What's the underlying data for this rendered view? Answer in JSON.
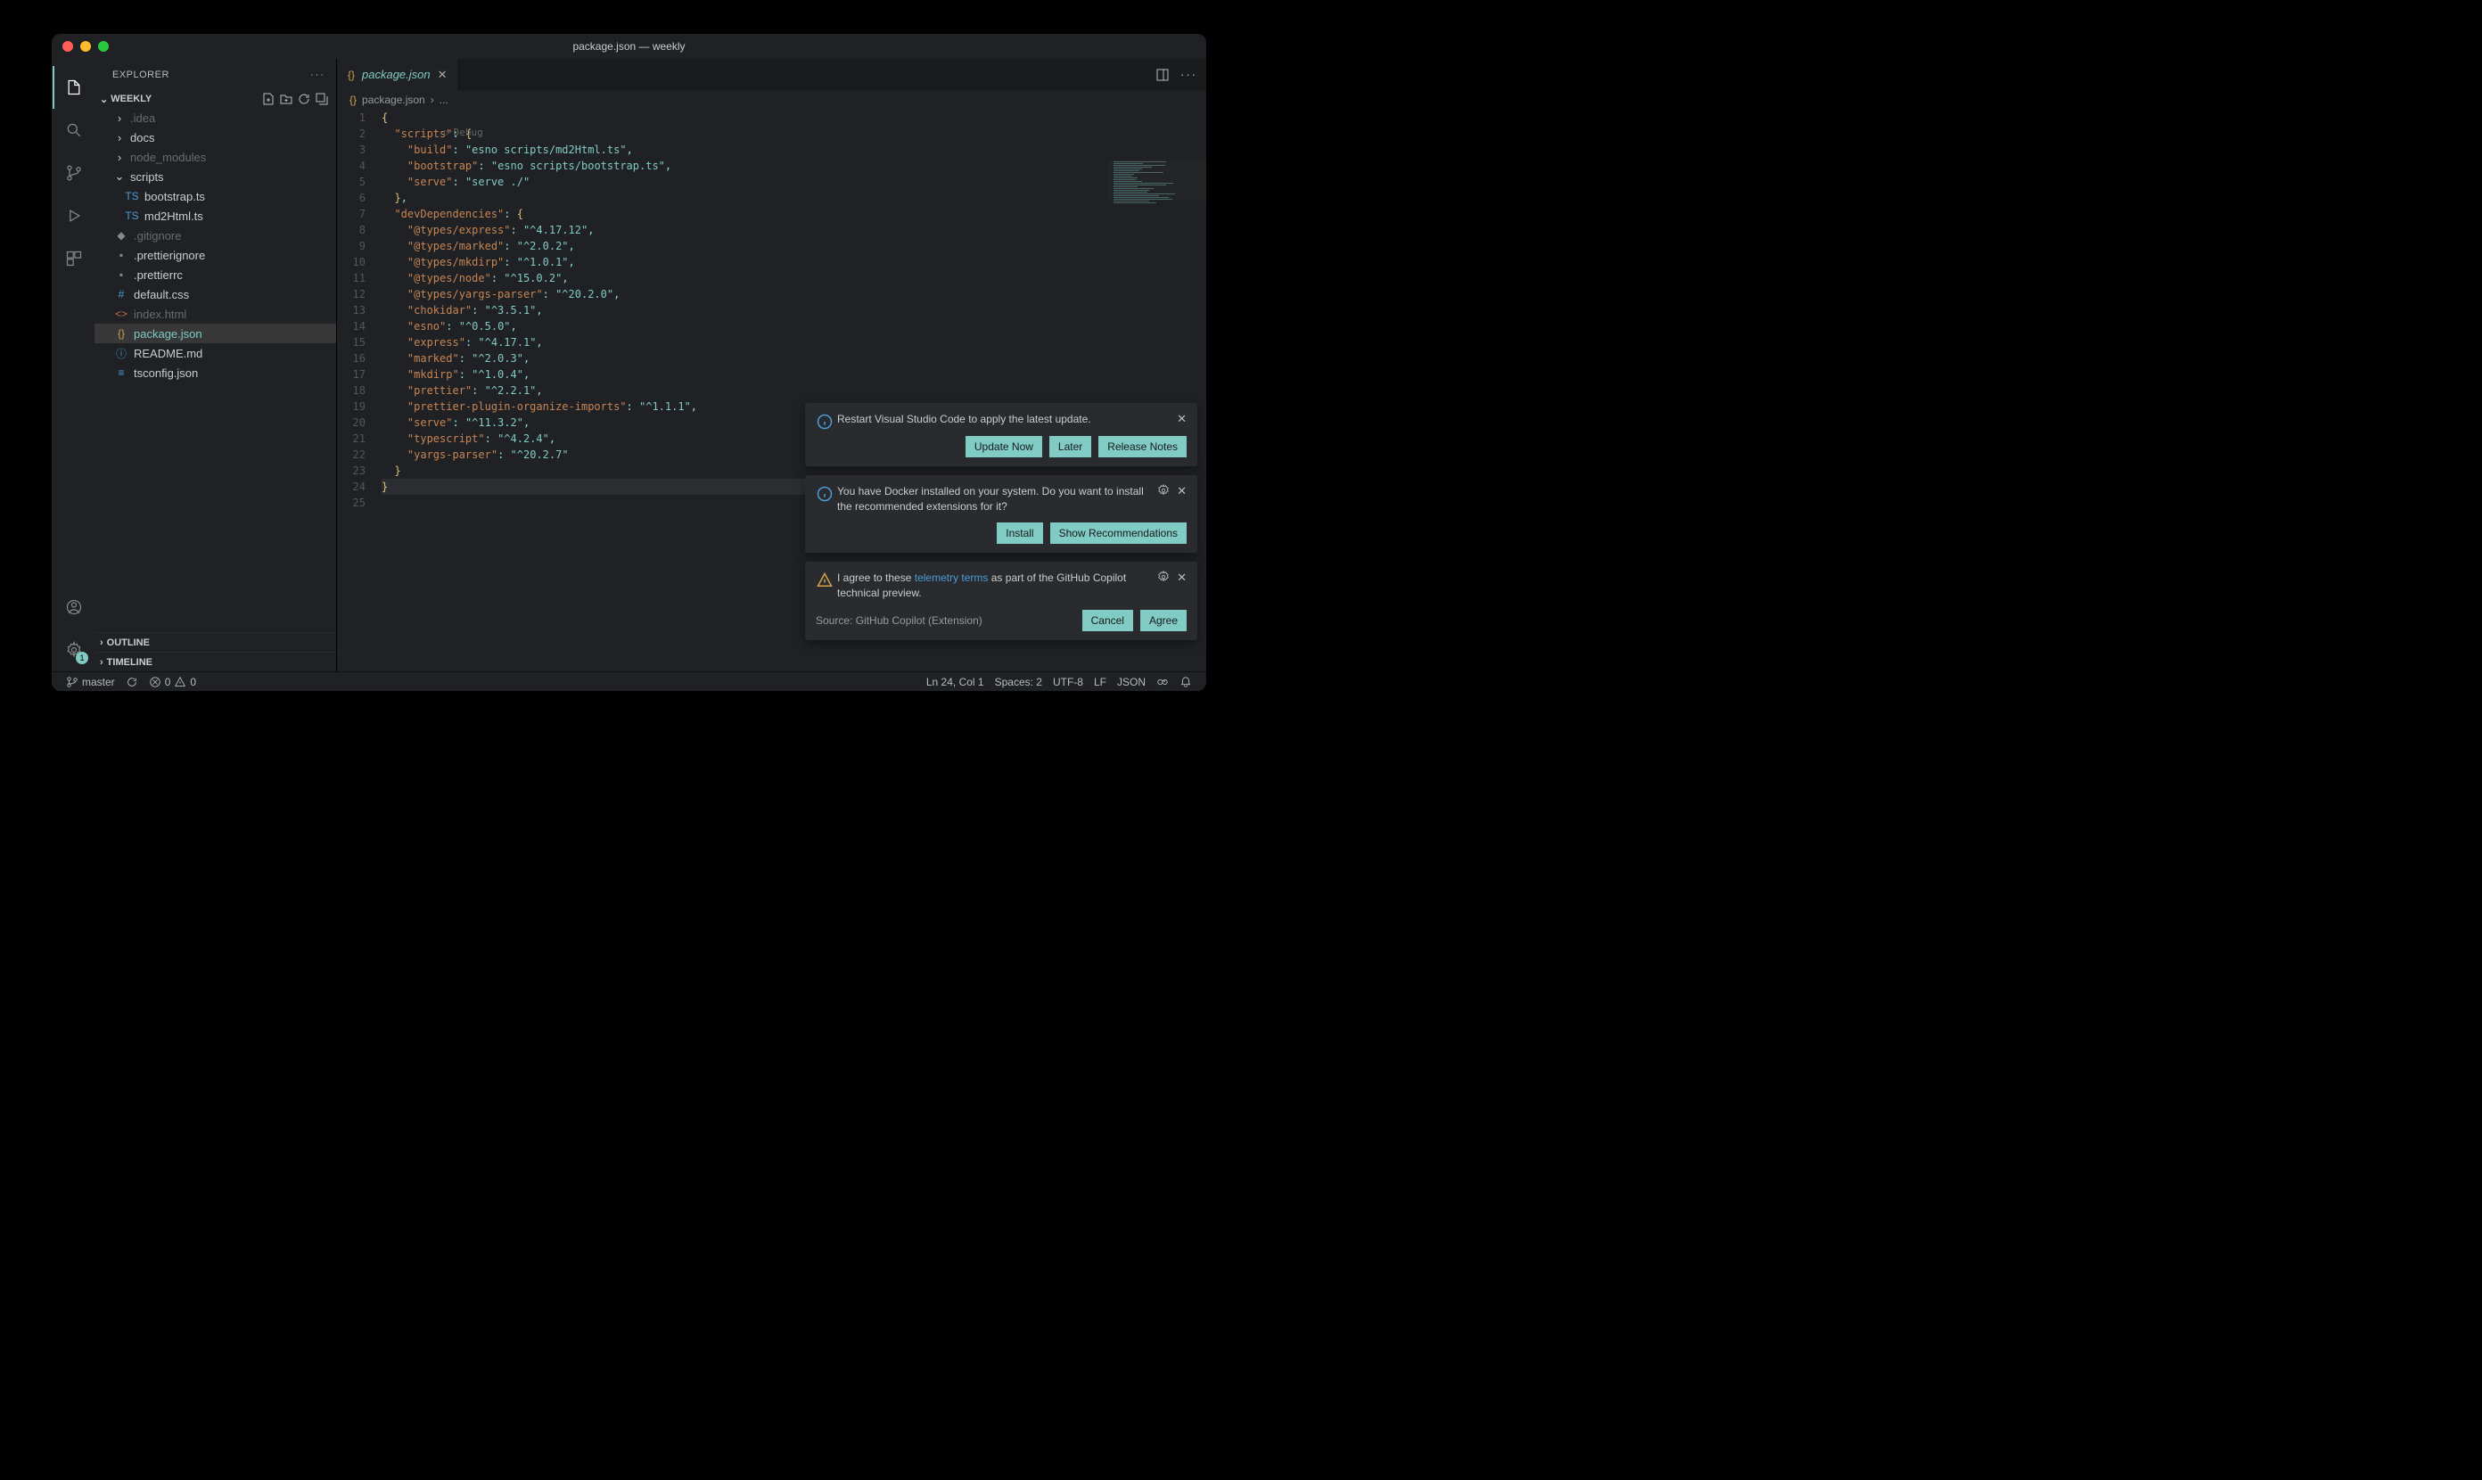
{
  "titlebar": {
    "title": "package.json — weekly"
  },
  "activitybar": {
    "settings_badge": "1"
  },
  "sidebar": {
    "header": "EXPLORER",
    "project": "WEEKLY",
    "tree": [
      {
        "name": ".idea",
        "type": "folder",
        "dim": true,
        "depth": 1
      },
      {
        "name": "docs",
        "type": "folder",
        "dim": false,
        "depth": 1
      },
      {
        "name": "node_modules",
        "type": "folder",
        "dim": true,
        "depth": 1
      },
      {
        "name": "scripts",
        "type": "folder",
        "dim": false,
        "depth": 1,
        "expanded": true
      },
      {
        "name": "bootstrap.ts",
        "type": "file",
        "icon": "TS",
        "iconColor": "#4a9dd8",
        "depth": 2
      },
      {
        "name": "md2Html.ts",
        "type": "file",
        "icon": "TS",
        "iconColor": "#4a9dd8",
        "depth": 2
      },
      {
        "name": ".gitignore",
        "type": "file",
        "icon": "◆",
        "iconColor": "#888",
        "dim": true,
        "depth": 1
      },
      {
        "name": ".prettierignore",
        "type": "file",
        "icon": "▪",
        "iconColor": "#888",
        "depth": 1
      },
      {
        "name": ".prettierrc",
        "type": "file",
        "icon": "▪",
        "iconColor": "#888",
        "depth": 1
      },
      {
        "name": "default.css",
        "type": "file",
        "icon": "#",
        "iconColor": "#4a9dd8",
        "depth": 1
      },
      {
        "name": "index.html",
        "type": "file",
        "icon": "<>",
        "iconColor": "#c0694f",
        "dim": true,
        "depth": 1
      },
      {
        "name": "package.json",
        "type": "file",
        "icon": "{}",
        "iconColor": "#cba54b",
        "depth": 1,
        "selected": true
      },
      {
        "name": "README.md",
        "type": "file",
        "icon": "ⓘ",
        "iconColor": "#4a9dd8",
        "depth": 1
      },
      {
        "name": "tsconfig.json",
        "type": "file",
        "icon": "≡",
        "iconColor": "#4a9dd8",
        "depth": 1
      }
    ],
    "outline": "OUTLINE",
    "timeline": "TIMELINE"
  },
  "tabs": {
    "active": "package.json"
  },
  "breadcrumb": {
    "file": "package.json",
    "sep": "›",
    "more": "..."
  },
  "debug_hint": "Debug",
  "code_lines": [
    [
      [
        "{",
        "brace"
      ]
    ],
    [
      [
        "  ",
        ""
      ],
      [
        "\"scripts\"",
        "key"
      ],
      [
        ": ",
        "punc"
      ],
      [
        "{",
        "brace"
      ]
    ],
    [
      [
        "    ",
        ""
      ],
      [
        "\"build\"",
        "key"
      ],
      [
        ": ",
        "punc"
      ],
      [
        "\"esno scripts/md2Html.ts\"",
        "str"
      ],
      [
        ",",
        "punc"
      ]
    ],
    [
      [
        "    ",
        ""
      ],
      [
        "\"bootstrap\"",
        "key"
      ],
      [
        ": ",
        "punc"
      ],
      [
        "\"esno scripts/bootstrap.ts\"",
        "str"
      ],
      [
        ",",
        "punc"
      ]
    ],
    [
      [
        "    ",
        ""
      ],
      [
        "\"serve\"",
        "key"
      ],
      [
        ": ",
        "punc"
      ],
      [
        "\"serve ./\"",
        "str"
      ]
    ],
    [
      [
        "  ",
        ""
      ],
      [
        "}",
        "brace"
      ],
      [
        ",",
        "punc"
      ]
    ],
    [
      [
        "  ",
        ""
      ],
      [
        "\"devDependencies\"",
        "key"
      ],
      [
        ": ",
        "punc"
      ],
      [
        "{",
        "brace"
      ]
    ],
    [
      [
        "    ",
        ""
      ],
      [
        "\"@types/express\"",
        "key"
      ],
      [
        ": ",
        "punc"
      ],
      [
        "\"^4.17.12\"",
        "str"
      ],
      [
        ",",
        "punc"
      ]
    ],
    [
      [
        "    ",
        ""
      ],
      [
        "\"@types/marked\"",
        "key"
      ],
      [
        ": ",
        "punc"
      ],
      [
        "\"^2.0.2\"",
        "str"
      ],
      [
        ",",
        "punc"
      ]
    ],
    [
      [
        "    ",
        ""
      ],
      [
        "\"@types/mkdirp\"",
        "key"
      ],
      [
        ": ",
        "punc"
      ],
      [
        "\"^1.0.1\"",
        "str"
      ],
      [
        ",",
        "punc"
      ]
    ],
    [
      [
        "    ",
        ""
      ],
      [
        "\"@types/node\"",
        "key"
      ],
      [
        ": ",
        "punc"
      ],
      [
        "\"^15.0.2\"",
        "str"
      ],
      [
        ",",
        "punc"
      ]
    ],
    [
      [
        "    ",
        ""
      ],
      [
        "\"@types/yargs-parser\"",
        "key"
      ],
      [
        ": ",
        "punc"
      ],
      [
        "\"^20.2.0\"",
        "str"
      ],
      [
        ",",
        "punc"
      ]
    ],
    [
      [
        "    ",
        ""
      ],
      [
        "\"chokidar\"",
        "key"
      ],
      [
        ": ",
        "punc"
      ],
      [
        "\"^3.5.1\"",
        "str"
      ],
      [
        ",",
        "punc"
      ]
    ],
    [
      [
        "    ",
        ""
      ],
      [
        "\"esno\"",
        "key"
      ],
      [
        ": ",
        "punc"
      ],
      [
        "\"^0.5.0\"",
        "str"
      ],
      [
        ",",
        "punc"
      ]
    ],
    [
      [
        "    ",
        ""
      ],
      [
        "\"express\"",
        "key"
      ],
      [
        ": ",
        "punc"
      ],
      [
        "\"^4.17.1\"",
        "str"
      ],
      [
        ",",
        "punc"
      ]
    ],
    [
      [
        "    ",
        ""
      ],
      [
        "\"marked\"",
        "key"
      ],
      [
        ": ",
        "punc"
      ],
      [
        "\"^2.0.3\"",
        "str"
      ],
      [
        ",",
        "punc"
      ]
    ],
    [
      [
        "    ",
        ""
      ],
      [
        "\"mkdirp\"",
        "key"
      ],
      [
        ": ",
        "punc"
      ],
      [
        "\"^1.0.4\"",
        "str"
      ],
      [
        ",",
        "punc"
      ]
    ],
    [
      [
        "    ",
        ""
      ],
      [
        "\"prettier\"",
        "key"
      ],
      [
        ": ",
        "punc"
      ],
      [
        "\"^2.2.1\"",
        "str"
      ],
      [
        ",",
        "punc"
      ]
    ],
    [
      [
        "    ",
        ""
      ],
      [
        "\"prettier-plugin-organize-imports\"",
        "key"
      ],
      [
        ": ",
        "punc"
      ],
      [
        "\"^1.1.1\"",
        "str"
      ],
      [
        ",",
        "punc"
      ]
    ],
    [
      [
        "    ",
        ""
      ],
      [
        "\"serve\"",
        "key"
      ],
      [
        ": ",
        "punc"
      ],
      [
        "\"^11.3.2\"",
        "str"
      ],
      [
        ",",
        "punc"
      ]
    ],
    [
      [
        "    ",
        ""
      ],
      [
        "\"typescript\"",
        "key"
      ],
      [
        ": ",
        "punc"
      ],
      [
        "\"^4.2.4\"",
        "str"
      ],
      [
        ",",
        "punc"
      ]
    ],
    [
      [
        "    ",
        ""
      ],
      [
        "\"yargs-parser\"",
        "key"
      ],
      [
        ": ",
        "punc"
      ],
      [
        "\"^20.2.7\"",
        "str"
      ]
    ],
    [
      [
        "  ",
        ""
      ],
      [
        "}",
        "brace"
      ]
    ],
    [
      [
        "}",
        "brace"
      ]
    ],
    []
  ],
  "notifications": [
    {
      "type": "info",
      "msg": "Restart Visual Studio Code to apply the latest update.",
      "buttons": [
        "Update Now",
        "Later",
        "Release Notes"
      ],
      "gear": false
    },
    {
      "type": "info",
      "msg": "You have Docker installed on your system. Do you want to install the recommended extensions for it?",
      "buttons": [
        "Install",
        "Show Recommendations"
      ],
      "gear": true
    },
    {
      "type": "warn",
      "msg_pre": "I agree to these ",
      "msg_link": "telemetry terms",
      "msg_post": " as part of the GitHub Copilot technical preview.",
      "source": "Source: GitHub Copilot (Extension)",
      "buttons": [
        "Cancel",
        "Agree"
      ],
      "gear": true
    }
  ],
  "statusbar": {
    "branch": "master",
    "errors": "0",
    "warnings": "0",
    "position": "Ln 24, Col 1",
    "spaces": "Spaces: 2",
    "encoding": "UTF-8",
    "eol": "LF",
    "lang": "JSON"
  }
}
